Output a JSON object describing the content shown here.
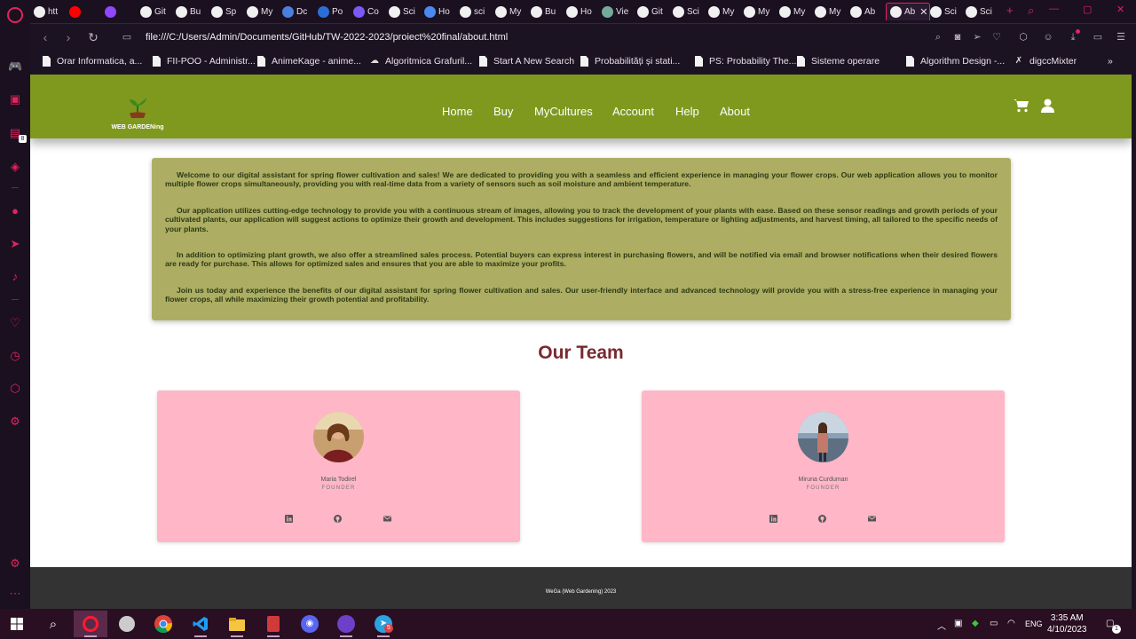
{
  "browser": {
    "tabs": [
      {
        "label": "htt",
        "icon": "github-icon",
        "fav": "#f0f0f0"
      },
      {
        "label": "",
        "icon": "youtube-icon",
        "fav": "#ff0000"
      },
      {
        "label": "",
        "icon": "twitch-icon",
        "fav": "#9146ff"
      },
      {
        "label": "Git",
        "icon": "github-icon",
        "fav": "#f0f0f0"
      },
      {
        "label": "Bu",
        "icon": "github-icon",
        "fav": "#f0f0f0"
      },
      {
        "label": "Sp",
        "icon": "github-icon",
        "fav": "#f0f0f0"
      },
      {
        "label": "My",
        "icon": "github-icon",
        "fav": "#f0f0f0"
      },
      {
        "label": "Dc",
        "icon": "docs-icon",
        "fav": "#4a7fe0"
      },
      {
        "label": "Po",
        "icon": "po-icon",
        "fav": "#2b6fd6"
      },
      {
        "label": "Co",
        "icon": "co-icon",
        "fav": "#7a5af5"
      },
      {
        "label": "Sci",
        "icon": "github-icon",
        "fav": "#f0f0f0"
      },
      {
        "label": "Ho",
        "icon": "ho-icon",
        "fav": "#4a8af0"
      },
      {
        "label": "sci",
        "icon": "google-icon",
        "fav": "#f0f0f0"
      },
      {
        "label": "My",
        "icon": "github-icon",
        "fav": "#f0f0f0"
      },
      {
        "label": "Bu",
        "icon": "github-icon",
        "fav": "#f0f0f0"
      },
      {
        "label": "Ho",
        "icon": "github-icon",
        "fav": "#f0f0f0"
      },
      {
        "label": "Vie",
        "icon": "chatgpt-icon",
        "fav": "#74aa9c"
      },
      {
        "label": "Git",
        "icon": "github-icon",
        "fav": "#f0f0f0"
      },
      {
        "label": "Sci",
        "icon": "github-icon",
        "fav": "#f0f0f0"
      },
      {
        "label": "My",
        "icon": "github-icon",
        "fav": "#f0f0f0"
      },
      {
        "label": "My",
        "icon": "github-icon",
        "fav": "#f0f0f0"
      },
      {
        "label": "My",
        "icon": "github-icon",
        "fav": "#f0f0f0"
      },
      {
        "label": "My",
        "icon": "github-icon",
        "fav": "#f0f0f0"
      },
      {
        "label": "Ab",
        "icon": "github-icon",
        "fav": "#f0f0f0"
      },
      {
        "label": "Ab",
        "icon": "github-icon",
        "fav": "#f0f0f0",
        "active": true
      },
      {
        "label": "Sci",
        "icon": "github-icon",
        "fav": "#f0f0f0"
      },
      {
        "label": "Sci",
        "icon": "github-icon",
        "fav": "#f0f0f0"
      }
    ],
    "url": "file:///C:/Users/Admin/Documents/GitHub/TW-2022-2023/proiect%20final/about.html",
    "bookmarks": [
      {
        "label": "Orar Informatica, a...",
        "icon": "doc"
      },
      {
        "label": "FII-POO - Administr...",
        "icon": "doc"
      },
      {
        "label": "AnimeKage - anime...",
        "icon": "doc"
      },
      {
        "label": "Algoritmica Grafuril...",
        "icon": "cloud"
      },
      {
        "label": "Start A New Search",
        "icon": "doc"
      },
      {
        "label": "Probabilități și stati...",
        "icon": "doc"
      },
      {
        "label": "PS: Probability The...",
        "icon": "doc"
      },
      {
        "label": "Sisteme operare",
        "icon": "doc"
      },
      {
        "label": "Algorithm Design -...",
        "icon": "doc"
      },
      {
        "label": "digccMixter",
        "icon": "x"
      }
    ],
    "sidebar_badge": "8",
    "accent": "#e0245e"
  },
  "site": {
    "logo_text": "WEB GARDENing",
    "nav": [
      "Home",
      "Buy",
      "MyCultures",
      "Account",
      "Help",
      "About"
    ],
    "header_color": "#7f991f",
    "about_paragraphs": [
      "Welcome to our digital assistant for spring flower cultivation and sales! We are dedicated to providing you with a seamless and efficient experience in managing your flower crops. Our web application allows you to monitor multiple flower crops simultaneously, providing you with real-time data from a variety of sensors such as soil moisture and ambient temperature.",
      "Our application utilizes cutting-edge technology to provide you with a continuous stream of images, allowing you to track the development of your plants with ease. Based on these sensor readings and growth periods of your cultivated plants, our application will suggest actions to optimize their growth and development. This includes suggestions for irrigation, temperature or lighting adjustments, and harvest timing, all tailored to the specific needs of your plants.",
      "In addition to optimizing plant growth, we also offer a streamlined sales process. Potential buyers can express interest in purchasing flowers, and will be notified via email and browser notifications when their desired flowers are ready for purchase. This allows for optimized sales and ensures that you are able to maximize your profits.",
      "Join us today and experience the benefits of our digital assistant for spring flower cultivation and sales. Our user-friendly interface and advanced technology will provide you with a stress-free experience in managing your flower crops, all while maximizing their growth potential and profitability."
    ],
    "team_title": "Our Team",
    "team": [
      {
        "name": "Maria Todirel",
        "role": "FOUNDER"
      },
      {
        "name": "Miruna Curduman",
        "role": "FOUNDER"
      }
    ],
    "footer": "WeGa (Web Gardening) 2023",
    "card_color": "#ffb6c6",
    "title_color": "#7a2930"
  },
  "taskbar": {
    "time": "3:35 AM",
    "date": "4/10/2023",
    "lang": "ENG",
    "notification_count": "1",
    "telegram_badge": "5"
  }
}
